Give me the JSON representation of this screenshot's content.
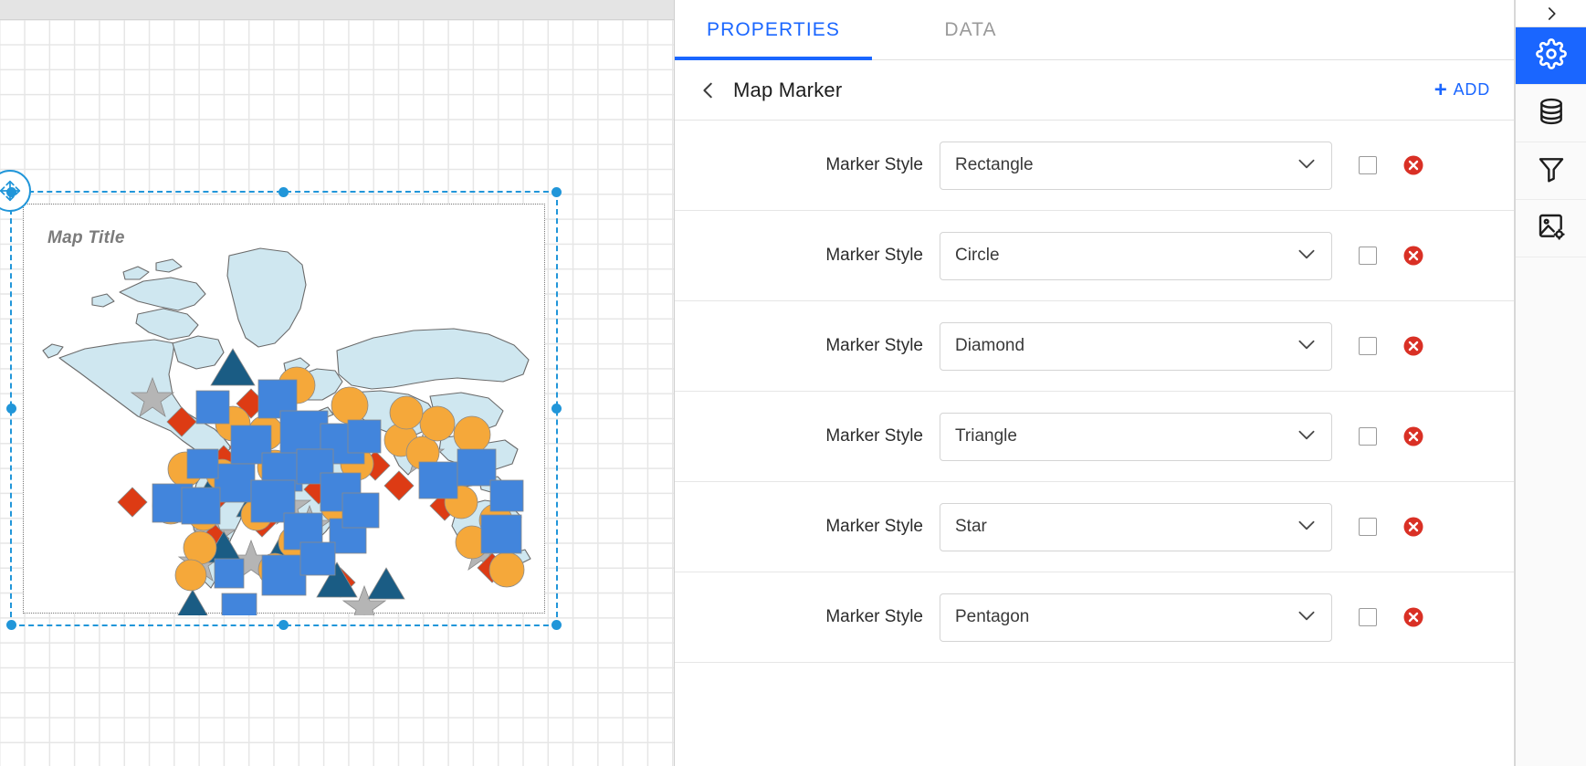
{
  "canvas": {
    "name": "design-canvas",
    "widget_title": "Map Title",
    "selection": {
      "move_handle_icon": "move-arrows-icon"
    },
    "map": {
      "land_color": "#cfe7f0",
      "land_stroke": "#6b6b6b",
      "marker_colors": {
        "rectangle": "#4285dc",
        "circle": "#f5a83a",
        "diamond": "#dd3b14",
        "triangle": "#1a5c84",
        "star": "#b5b5b5"
      }
    }
  },
  "panel": {
    "tabs": [
      {
        "label": "PROPERTIES",
        "active": true
      },
      {
        "label": "DATA",
        "active": false
      }
    ],
    "back_icon": "chevron-left-icon",
    "title": "Map Marker",
    "add_label": "ADD",
    "add_icon": "plus-icon",
    "row_label": "Marker Style",
    "dropdown_icon": "chevron-down-icon",
    "delete_icon": "delete-circle-icon",
    "rows": [
      {
        "label": "Marker Style",
        "value": "Rectangle",
        "checked": false
      },
      {
        "label": "Marker Style",
        "value": "Circle",
        "checked": false
      },
      {
        "label": "Marker Style",
        "value": "Diamond",
        "checked": false
      },
      {
        "label": "Marker Style",
        "value": "Triangle",
        "checked": false
      },
      {
        "label": "Marker Style",
        "value": "Star",
        "checked": false
      },
      {
        "label": "Marker Style",
        "value": "Pentagon",
        "checked": false
      }
    ]
  },
  "rail": {
    "expand_icon": "chevron-right-icon",
    "items": [
      {
        "icon": "gear-icon",
        "name": "settings",
        "active": true
      },
      {
        "icon": "database-icon",
        "name": "data-source",
        "active": false
      },
      {
        "icon": "filter-icon",
        "name": "filter",
        "active": false
      },
      {
        "icon": "image-settings-icon",
        "name": "image-settings",
        "active": false
      }
    ],
    "accent": "#1a66ff"
  }
}
